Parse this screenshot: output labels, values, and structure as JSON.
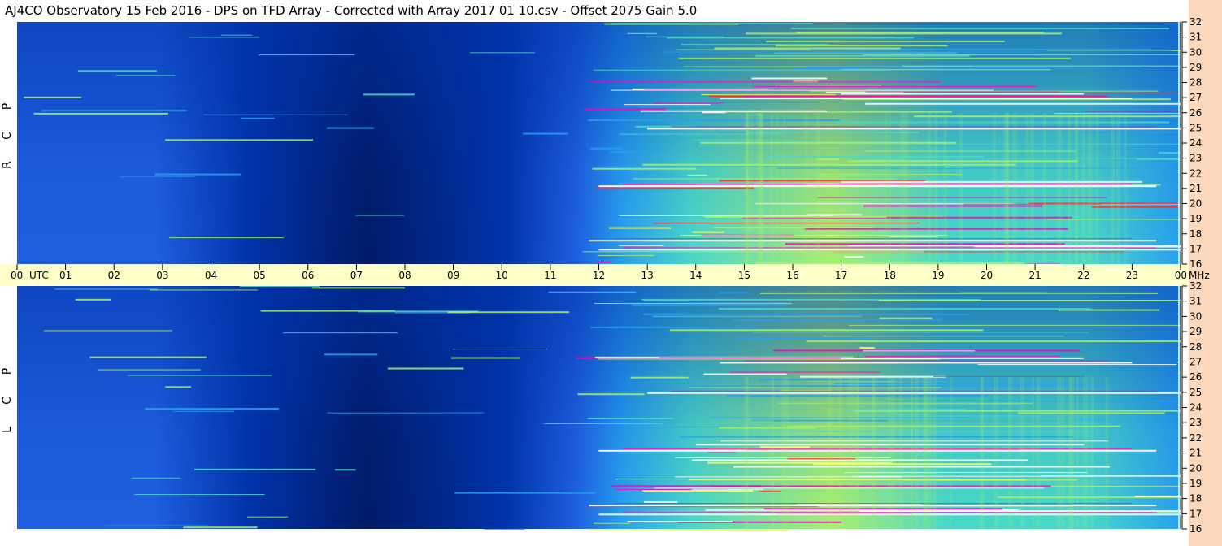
{
  "title": "AJ4CO Observatory  15 Feb 2016  -  DPS on TFD Array  -  Corrected with Array 2017 01 10.csv  -  Offset 2075  Gain 5.0",
  "colors": {
    "background": "#ffffff",
    "time_axis_band": "#ffffc8",
    "freq_axis_panel": "#fcd9bd",
    "colormap": [
      "#001a66",
      "#0033aa",
      "#1f5fe0",
      "#28a0f0",
      "#4ad8c8",
      "#a8f070",
      "#ffff60",
      "#ff3030",
      "#ff00c0",
      "#ffffff"
    ]
  },
  "chart_data": [
    {
      "type": "heatmap",
      "panel": "upper",
      "polarization_label": [
        "R",
        "C",
        "P"
      ],
      "x_ticks": [
        "00",
        "01",
        "02",
        "03",
        "04",
        "05",
        "06",
        "07",
        "08",
        "09",
        "10",
        "11",
        "12",
        "13",
        "14",
        "15",
        "16",
        "17",
        "18",
        "19",
        "20",
        "21",
        "22",
        "23",
        "00"
      ],
      "x_unit": "UTC",
      "x_range_hours": [
        0,
        24
      ],
      "y_ticks": [
        "16",
        "17",
        "18",
        "19",
        "20",
        "21",
        "22",
        "23",
        "24",
        "25",
        "26",
        "27",
        "28",
        "29",
        "30",
        "31",
        "32"
      ],
      "y_unit": "MHz",
      "y_range_mhz": [
        16,
        32
      ],
      "grid": false
    },
    {
      "type": "heatmap",
      "panel": "lower",
      "polarization_label": [
        "L",
        "C",
        "P"
      ],
      "x_range_hours": [
        0,
        24
      ],
      "y_ticks": [
        "16",
        "17",
        "18",
        "19",
        "20",
        "21",
        "22",
        "23",
        "24",
        "25",
        "26",
        "27",
        "28",
        "29",
        "30",
        "31",
        "32"
      ],
      "y_range_mhz": [
        16,
        32
      ],
      "grid": false
    }
  ]
}
